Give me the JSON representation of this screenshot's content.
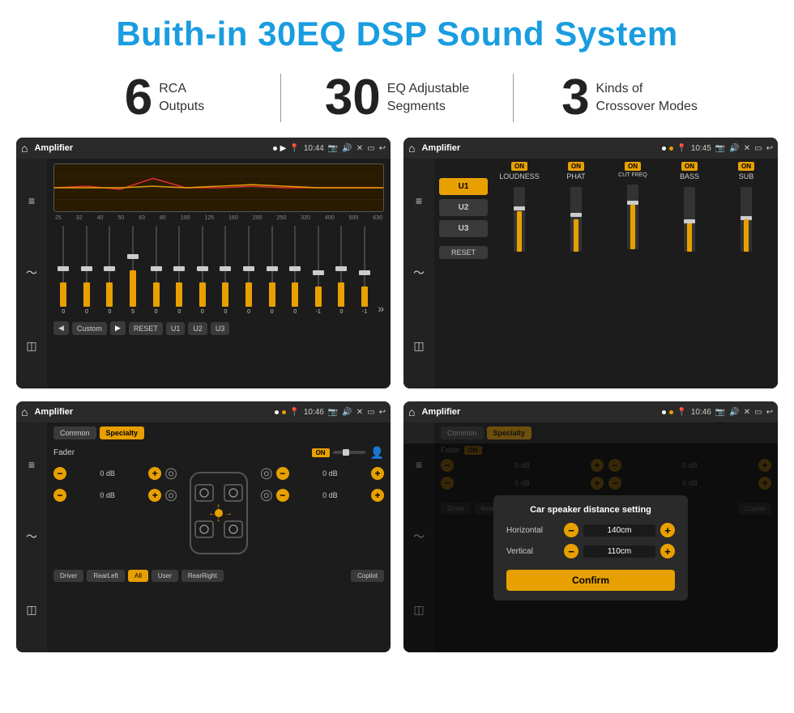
{
  "page": {
    "title": "Buith-in 30EQ DSP Sound System",
    "bg_color": "#ffffff"
  },
  "features": [
    {
      "number": "6",
      "text_line1": "RCA",
      "text_line2": "Outputs"
    },
    {
      "number": "30",
      "text_line1": "EQ Adjustable",
      "text_line2": "Segments"
    },
    {
      "number": "3",
      "text_line1": "Kinds of",
      "text_line2": "Crossover Modes"
    }
  ],
  "screen1": {
    "title": "Amplifier",
    "time": "10:44",
    "eq_labels": [
      "25",
      "32",
      "40",
      "50",
      "63",
      "80",
      "100",
      "125",
      "160",
      "200",
      "250",
      "320",
      "400",
      "500",
      "630"
    ],
    "eq_values": [
      0,
      0,
      0,
      5,
      0,
      0,
      0,
      0,
      0,
      0,
      0,
      -1,
      0,
      -1
    ],
    "buttons": [
      "Custom",
      "RESET",
      "U1",
      "U2",
      "U3"
    ]
  },
  "screen2": {
    "title": "Amplifier",
    "time": "10:45",
    "channels": [
      "LOUDNESS",
      "PHAT",
      "CUT FREQ",
      "BASS",
      "SUB"
    ],
    "presets": [
      "U1",
      "U2",
      "U3"
    ],
    "reset_label": "RESET"
  },
  "screen3": {
    "title": "Amplifier",
    "time": "10:46",
    "tabs": [
      "Common",
      "Specialty"
    ],
    "fader_label": "Fader",
    "on_label": "ON",
    "db_values": [
      "0 dB",
      "0 dB",
      "0 dB",
      "0 dB"
    ],
    "bottom_btns": [
      "Driver",
      "RearLeft",
      "All",
      "User",
      "RearRight",
      "Copilot"
    ]
  },
  "screen4": {
    "title": "Amplifier",
    "time": "10:46",
    "tabs": [
      "Common",
      "Specialty"
    ],
    "dialog": {
      "title": "Car speaker distance setting",
      "rows": [
        {
          "label": "Horizontal",
          "value": "140cm"
        },
        {
          "label": "Vertical",
          "value": "110cm"
        }
      ],
      "confirm_label": "Confirm"
    }
  }
}
